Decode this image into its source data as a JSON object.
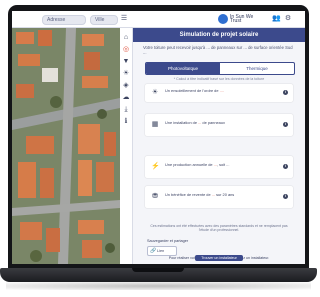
{
  "topbar": {
    "search_1": "Adresse",
    "search_2": "Ville",
    "brand": "In Sun We Trust"
  },
  "panel": {
    "title": "Simulation de projet solaire",
    "intro": "Votre toiture peut recevoir jusqu'à ... de panneaux sur ... de surface orientée Sud ...",
    "tabs": [
      "Photovoltaïque",
      "Thermique"
    ],
    "note": "* Calcul à titre indicatif basé sur les données de la toiture",
    "cards": [
      {
        "icon": "sun-icon",
        "text_before": "Un ensoleillement de l'ordre de ",
        "highlight": "....",
        "text_after": ""
      },
      {
        "icon": "panel-icon",
        "text_before": "Une installation de ",
        "highlight": "...",
        "text_after": " de panneaux"
      },
      {
        "icon": "bolt-icon",
        "text_before": "Une production annuelle de ",
        "highlight": "...",
        "text_after": ", soit ..."
      },
      {
        "icon": "coins-icon",
        "text_before": "Un bénéfice de revente de ",
        "highlight": "...",
        "text_after": " sur 20 ans"
      }
    ],
    "footnote": "Ces estimations ont été effectuées avec des paramètres standards et ne remplacent pas l'étude d'un professionnel.",
    "share_label": "Sauvegarder et partager",
    "share_button": "Lien",
    "bottom_text": "Pour réaliser votre installation solaire, contactez un installateur.",
    "cta": "Trouver un installateur"
  },
  "colors": {
    "accent": "#3c4a8c",
    "highlight": "#e0503d"
  }
}
